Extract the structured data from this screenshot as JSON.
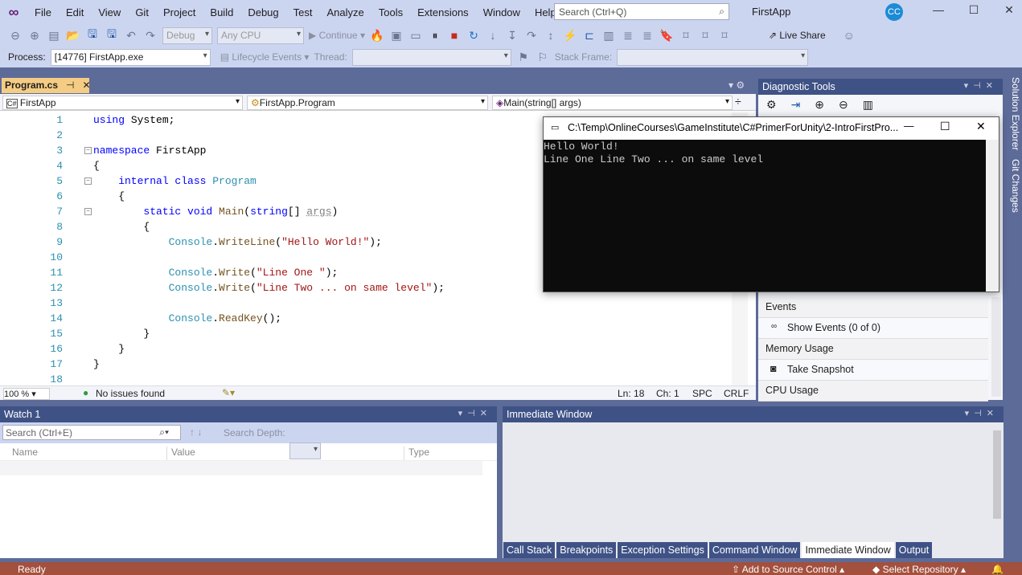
{
  "menu": {
    "items": [
      "File",
      "Edit",
      "View",
      "Git",
      "Project",
      "Build",
      "Debug",
      "Test",
      "Analyze",
      "Tools",
      "Extensions",
      "Window",
      "Help"
    ],
    "search_placeholder": "Search (Ctrl+Q)",
    "app_title": "FirstApp",
    "avatar": "CC"
  },
  "toolbar": {
    "config": "Debug",
    "platform": "Any CPU",
    "continue": "Continue",
    "live_share": "Live Share",
    "process_label": "Process:",
    "process": "[14776] FirstApp.exe",
    "lifecycle": "Lifecycle Events",
    "thread_label": "Thread:",
    "stack_frame_label": "Stack Frame:"
  },
  "editor": {
    "tab": "Program.cs",
    "nav_project": "FirstApp",
    "nav_class": "FirstApp.Program",
    "nav_member": "Main(string[] args)",
    "lines": [
      [
        [
          "using ",
          "kw"
        ],
        [
          "System;",
          "pl"
        ]
      ],
      [],
      [
        [
          "namespace ",
          "kw"
        ],
        [
          "FirstApp",
          "pl"
        ]
      ],
      [
        [
          "{",
          "pl"
        ]
      ],
      [
        [
          "    internal ",
          "kw"
        ],
        [
          "class ",
          "kw"
        ],
        [
          "Program",
          "ty"
        ]
      ],
      [
        [
          "    {",
          "pl"
        ]
      ],
      [
        [
          "        static ",
          "kw"
        ],
        [
          "void ",
          "kw"
        ],
        [
          "Main",
          "me"
        ],
        [
          "(",
          "pl"
        ],
        [
          "string",
          "kw"
        ],
        [
          "[] ",
          "pl"
        ],
        [
          "args",
          "pa"
        ],
        [
          ")",
          "pl"
        ]
      ],
      [
        [
          "        {",
          "pl"
        ]
      ],
      [
        [
          "            Console",
          "ty"
        ],
        [
          ".",
          "pl"
        ],
        [
          "WriteLine",
          "me"
        ],
        [
          "(",
          "pl"
        ],
        [
          "\"Hello World!\"",
          "st"
        ],
        [
          ");",
          "pl"
        ]
      ],
      [],
      [
        [
          "            Console",
          "ty"
        ],
        [
          ".",
          "pl"
        ],
        [
          "Write",
          "me"
        ],
        [
          "(",
          "pl"
        ],
        [
          "\"Line One \"",
          "st"
        ],
        [
          ");",
          "pl"
        ]
      ],
      [
        [
          "            Console",
          "ty"
        ],
        [
          ".",
          "pl"
        ],
        [
          "Write",
          "me"
        ],
        [
          "(",
          "pl"
        ],
        [
          "\"Line Two ... on same level\"",
          "st"
        ],
        [
          ");",
          "pl"
        ]
      ],
      [],
      [
        [
          "            Console",
          "ty"
        ],
        [
          ".",
          "pl"
        ],
        [
          "ReadKey",
          "me"
        ],
        [
          "();",
          "pl"
        ]
      ],
      [
        [
          "        }",
          "pl"
        ]
      ],
      [
        [
          "    }",
          "pl"
        ]
      ],
      [
        [
          "}",
          "pl"
        ]
      ],
      []
    ],
    "zoom": "100 %",
    "issues": "No issues found",
    "ln": "Ln: 18",
    "ch": "Ch: 1",
    "spc": "SPC",
    "crlf": "CRLF"
  },
  "console": {
    "title": "C:\\Temp\\OnlineCourses\\GameInstitute\\C#PrimerForUnity\\2-IntroFirstPro...",
    "output": "Hello World!\nLine One Line Two ... on same level"
  },
  "diagnostic": {
    "title": "Diagnostic Tools",
    "events": "Events",
    "show_events": "Show Events (0 of 0)",
    "memory": "Memory Usage",
    "snapshot": "Take Snapshot",
    "cpu": "CPU Usage"
  },
  "side_tabs": [
    "Solution Explorer",
    "Git Changes"
  ],
  "watch": {
    "title": "Watch 1",
    "search_placeholder": "Search (Ctrl+E)",
    "search_depth": "Search Depth:",
    "columns": [
      "Name",
      "Value",
      "Type"
    ]
  },
  "immediate": {
    "title": "Immediate Window",
    "tabs": [
      "Call Stack",
      "Breakpoints",
      "Exception Settings",
      "Command Window",
      "Immediate Window",
      "Output"
    ],
    "active_tab": "Immediate Window"
  },
  "status": {
    "ready": "Ready",
    "source_control": "Add to Source Control",
    "repository": "Select Repository"
  }
}
